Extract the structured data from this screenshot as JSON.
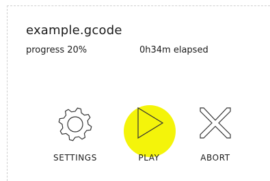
{
  "job": {
    "filename": "example.gcode",
    "progress_text": "progress 20%",
    "elapsed_text": "0h34m elapsed",
    "progress_percent": 20
  },
  "controls": {
    "settings": {
      "label": "SETTINGS",
      "icon": "gear-icon"
    },
    "play": {
      "label": "PLAY",
      "icon": "play-icon",
      "highlight_color": "#f4f40a"
    },
    "abort": {
      "label": "ABORT",
      "icon": "close-icon"
    }
  }
}
